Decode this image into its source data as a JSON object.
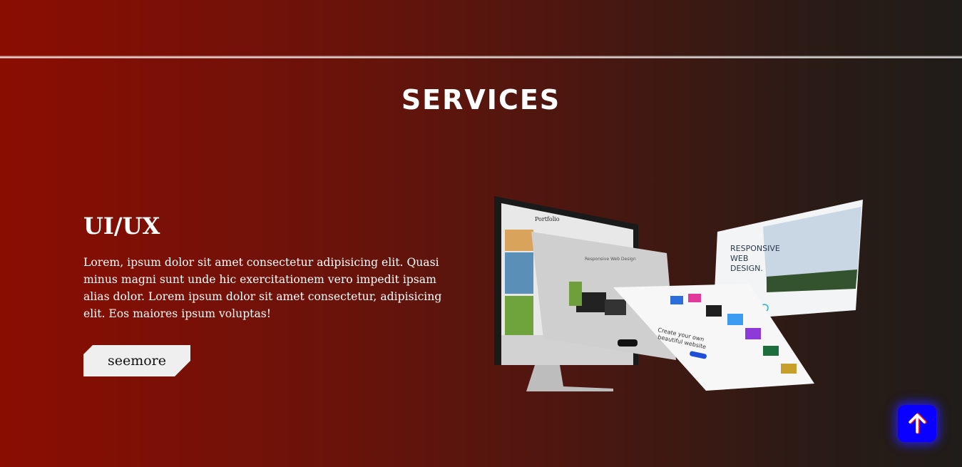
{
  "section": {
    "title": "SERVICES"
  },
  "service": {
    "title": "UI/UX",
    "description": "Lorem, ipsum dolor sit amet consectetur adipisicing elit. Quasi minus magni sunt unde hic exercitationem vero impedit ipsam alias dolor. Lorem ipsum dolor sit amet consectetur, adipisicing elit. Eos maiores ipsum voluptas!",
    "button_label": "seemore"
  },
  "illustration": {
    "portfolio_label": "Portfolio",
    "screen_heading": "Responsive Web Design",
    "responsive_heading": [
      "RESPONSIVE",
      "WEB",
      "DESIGN."
    ],
    "create_heading": [
      "Create your own",
      "beautiful website"
    ]
  },
  "scroll_top": {
    "icon": "arrow-up-icon"
  },
  "colors": {
    "background_left": "#8b0d02",
    "background_right": "#201c19",
    "button_bg": "#efefef",
    "scroll_top_bg": "#0a00ff",
    "scroll_top_arrow_accent": "#ff1a1a"
  }
}
